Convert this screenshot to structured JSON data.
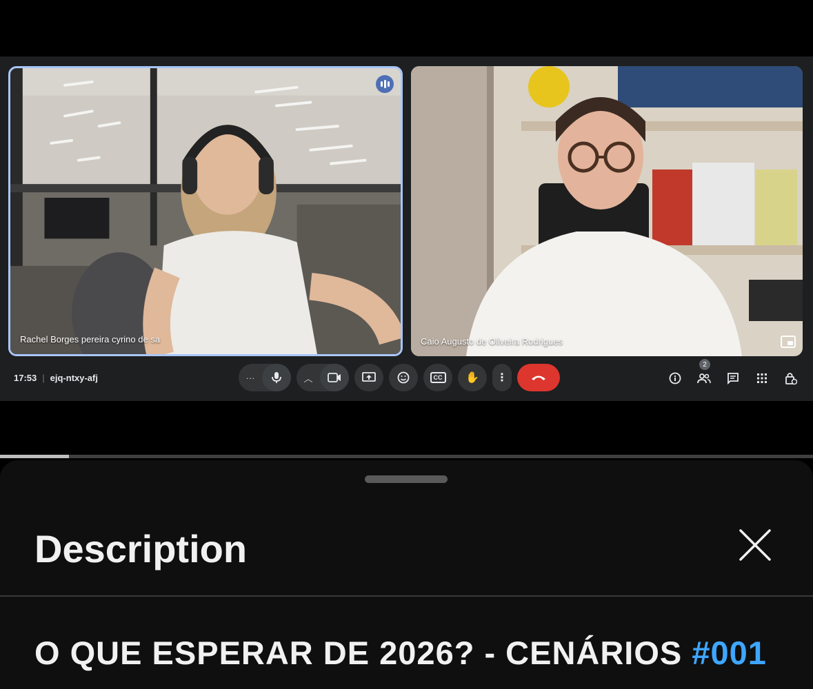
{
  "meeting": {
    "time": "17:53",
    "code": "ejq-ntxy-afj",
    "participants_count": "2",
    "tiles": [
      {
        "name": "Rachel Borges pereira cyrino de sa",
        "speaking": true
      },
      {
        "name": "Caio Augusto de Oliveira Rodrigues",
        "speaking": false
      }
    ],
    "controls": [
      "more-options-icon",
      "mic-icon",
      "chevron-up-icon",
      "camera-icon",
      "present-icon",
      "emoji-icon",
      "captions-icon",
      "raise-hand-icon",
      "kebab-icon",
      "end-call-icon"
    ],
    "right_icons": [
      "info-icon",
      "people-icon",
      "chat-icon",
      "activities-icon",
      "host-controls-icon"
    ],
    "captions_label": "CC"
  },
  "player": {
    "progress": 0.085
  },
  "description_sheet": {
    "heading": "Description",
    "video_title": "O QUE ESPERAR DE 2026? - CENÁRIOS",
    "hashtag": "#001"
  },
  "colors": {
    "accent": "#a8c7fa",
    "end_call": "#dc362e",
    "hashtag": "#3ea6ff"
  }
}
